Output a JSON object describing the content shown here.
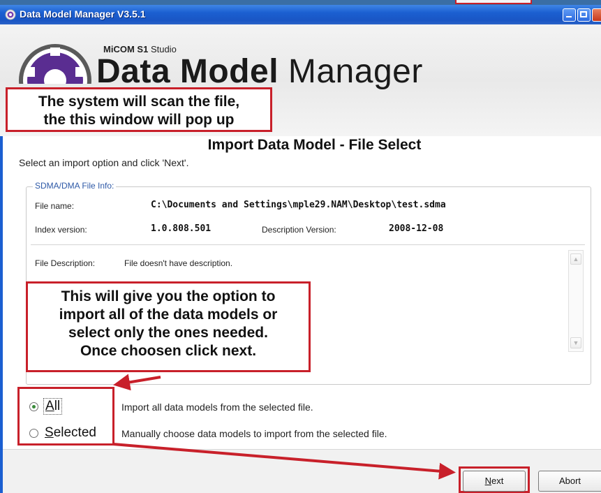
{
  "window": {
    "title": "Data Model Manager V3.5.1"
  },
  "header": {
    "brand_prefix": "MiCOM",
    "brand_s1": "S1",
    "brand_suffix": "Studio",
    "product_bold": "Data Model",
    "product_light": "Manager"
  },
  "annotations": {
    "callout_top_line1": "The system will scan the file,",
    "callout_top_line2": "the this window will pop up",
    "callout_mid_line1": "This will give you the option to",
    "callout_mid_line2": "import all of the data models or",
    "callout_mid_line3": "select only the ones needed.",
    "callout_mid_line4": "Once choosen click next.",
    "accent_color": "#c8202a"
  },
  "dialog": {
    "title": "Import Data Model - File Select",
    "instruction": "Select an import option and click 'Next'."
  },
  "file_info": {
    "group_label": "SDMA/DMA File Info:",
    "file_name_label": "File name:",
    "file_name_value": "C:\\Documents and Settings\\mple29.NAM\\Desktop\\test.sdma",
    "index_version_label": "Index version:",
    "index_version_value": "1.0.808.501",
    "description_version_label": "Description Version:",
    "description_version_value": "2008-12-08",
    "file_description_label": "File Description:",
    "file_description_value": "File doesn't have description."
  },
  "options": {
    "all_mnemonic": "A",
    "all_rest": "ll",
    "all_description": "Import all data models from the selected file.",
    "selected_mnemonic": "S",
    "selected_rest": "elected",
    "selected_description": "Manually choose data models to import from the selected file.",
    "selected_option": "All"
  },
  "footer": {
    "next_mnemonic": "N",
    "next_rest": "ext",
    "abort_label": "Abort"
  },
  "icons": [
    "app-gear-icon",
    "minimize-icon",
    "maximize-icon",
    "close-icon",
    "logo-gear-icon",
    "scroll-up-icon",
    "scroll-down-icon"
  ]
}
